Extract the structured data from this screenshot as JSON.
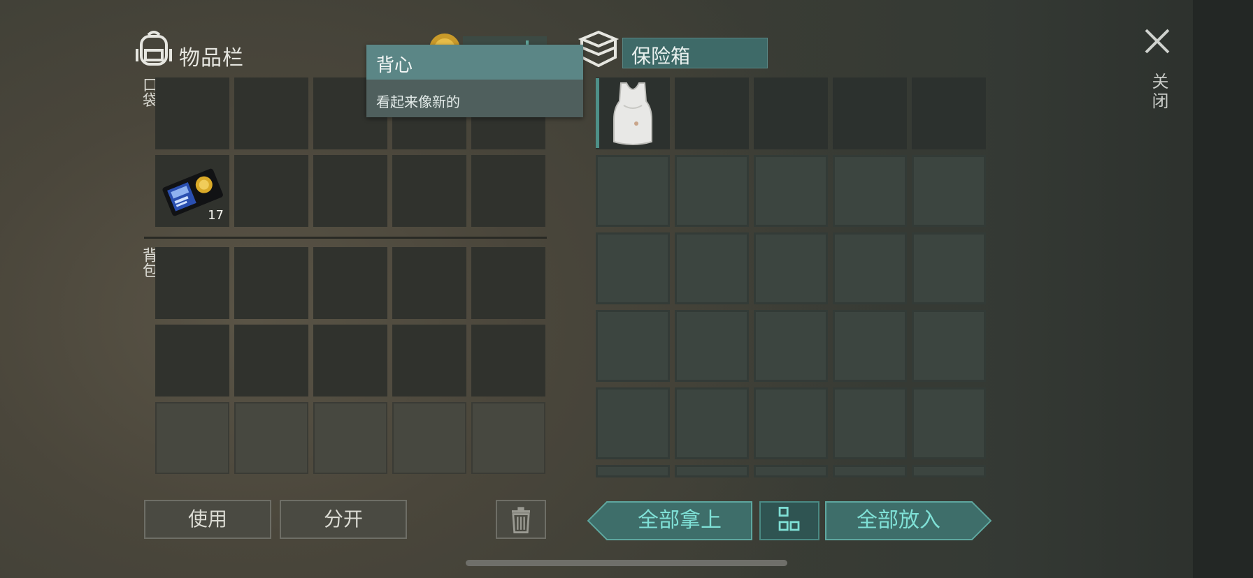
{
  "inventory": {
    "title": "物品栏",
    "pocket_label": "口袋",
    "backpack_label": "背包",
    "badge_item_qty": "17"
  },
  "storage": {
    "title": "保险箱"
  },
  "tooltip": {
    "name": "背心",
    "description": "看起来像新的"
  },
  "buttons": {
    "use": "使用",
    "split": "分开",
    "take_all": "全部拿上",
    "put_all": "全部放入"
  },
  "close": {
    "label": "关闭"
  },
  "colors": {
    "accent_teal": "#7fe0d6",
    "header_teal": "#3e6a68",
    "tooltip_head": "#5b8686"
  },
  "icons": [
    "backpack-icon",
    "coin-icon",
    "chest-icon",
    "badge-wallet-icon",
    "tank-top-icon",
    "trash-icon",
    "sort-grid-icon",
    "close-icon"
  ]
}
